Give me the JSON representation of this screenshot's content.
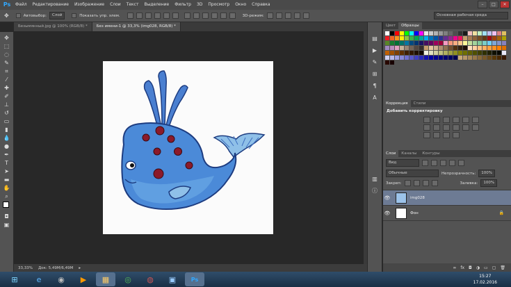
{
  "menubar": {
    "logo": "Ps",
    "items": [
      "Файл",
      "Редактирование",
      "Изображение",
      "Слои",
      "Текст",
      "Выделение",
      "Фильтр",
      "3D",
      "Просмотр",
      "Окно",
      "Справка"
    ]
  },
  "options": {
    "autoselect_label": "Автовыбор:",
    "autoselect_value": "Слой",
    "show_controls": "Показать упр. элем.",
    "mode3d": "3D-режим:",
    "workspace": "Основная рабочая среда"
  },
  "tabs": [
    {
      "label": "Безымянный.jpg @ 100% (RGB/8) *"
    },
    {
      "label": "Без имени-1 @ 33,3% (img028, RGB/8) *"
    }
  ],
  "status": {
    "zoom": "33,33%",
    "doc": "Док: 5,49М/6,49М"
  },
  "panels": {
    "swatch_tabs": [
      "Цвет",
      "Образцы"
    ],
    "adj_tabs": [
      "Коррекция",
      "Стили"
    ],
    "adj_title": "Добавить корректировку",
    "layers_tabs": [
      "Слои",
      "Каналы",
      "Контуры"
    ],
    "kind": "Вид",
    "blend": "Обычные",
    "opacity_label": "Непрозрачность:",
    "opacity_value": "100%",
    "lock_label": "Закреп:",
    "fill_label": "Заливка:",
    "fill_value": "100%",
    "layers": [
      {
        "name": "img028",
        "selected": true
      },
      {
        "name": "Фон",
        "selected": false
      }
    ]
  },
  "taskbar": {
    "time": "15:27",
    "date": "17.02.2016"
  },
  "swatch_colors": [
    "#ffffff",
    "#000000",
    "#ff0000",
    "#ffff00",
    "#00ff00",
    "#00ffff",
    "#0000ff",
    "#ff00ff",
    "#e6e6e6",
    "#cccccc",
    "#b3b3b3",
    "#999999",
    "#808080",
    "#666666",
    "#4d4d4d",
    "#333333",
    "#1a1a1a",
    "#f5c0c0",
    "#f0e0a0",
    "#c0f0c0",
    "#a0e0f0",
    "#c0c0f0",
    "#f0c0f0",
    "#e08080",
    "#e0c060",
    "#ed1c24",
    "#f26522",
    "#f7941d",
    "#fff200",
    "#8dc63f",
    "#39b54a",
    "#00a651",
    "#00a99d",
    "#00aeef",
    "#0072bc",
    "#0054a6",
    "#2e3192",
    "#662d91",
    "#92278f",
    "#ec008c",
    "#ed145b",
    "#c69c6d",
    "#a67c52",
    "#8c6239",
    "#754c24",
    "#603913",
    "#9e0b0f",
    "#a0410d",
    "#a36209",
    "#aba000",
    "#598527",
    "#197b30",
    "#007236",
    "#00746b",
    "#0076a3",
    "#004a80",
    "#003471",
    "#1b1464",
    "#440e62",
    "#630460",
    "#9e005d",
    "#9e0039",
    "#f49ac1",
    "#f7977a",
    "#fbad82",
    "#fdc68c",
    "#fff799",
    "#c4df9b",
    "#a2d39c",
    "#82ca9c",
    "#7bcdc8",
    "#6ecff6",
    "#7ea7d8",
    "#8493ca",
    "#8882be",
    "#a187be",
    "#bc8dbf",
    "#e0a0c0",
    "#c7b299",
    "#998675",
    "#736357",
    "#534741",
    "#362f2d",
    "#c69c6d",
    "#e6c8a0",
    "#d0b090",
    "#b09070",
    "#907050",
    "#705030",
    "#503010",
    "#302010",
    "#201008",
    "#ffe0c0",
    "#ffd0a0",
    "#ffc080",
    "#ffb060",
    "#ffa040",
    "#ff9020",
    "#ff8000",
    "#e07000",
    "#c06000",
    "#a05000",
    "#804000",
    "#603000",
    "#402000",
    "#301800",
    "#201000",
    "#100800",
    "#f0f0e0",
    "#e0e0c0",
    "#d0d0a0",
    "#c0c080",
    "#b0b060",
    "#a0a040",
    "#909020",
    "#808000",
    "#707000",
    "#606000",
    "#505000",
    "#404000",
    "#303000",
    "#202000",
    "#101000",
    "#080800",
    "#e8e8f8",
    "#d0d0f0",
    "#b8b8e8",
    "#a0a0e0",
    "#8888d8",
    "#7070d0",
    "#5858c8",
    "#4040c0",
    "#2828b8",
    "#1010b0",
    "#0000a0",
    "#000090",
    "#000080",
    "#000070",
    "#000060",
    "#000050",
    "#c8a878",
    "#b89868",
    "#a88858",
    "#987848",
    "#886838",
    "#785828",
    "#684818",
    "#583808",
    "#482800",
    "#381800",
    "#280800",
    "#180000"
  ]
}
